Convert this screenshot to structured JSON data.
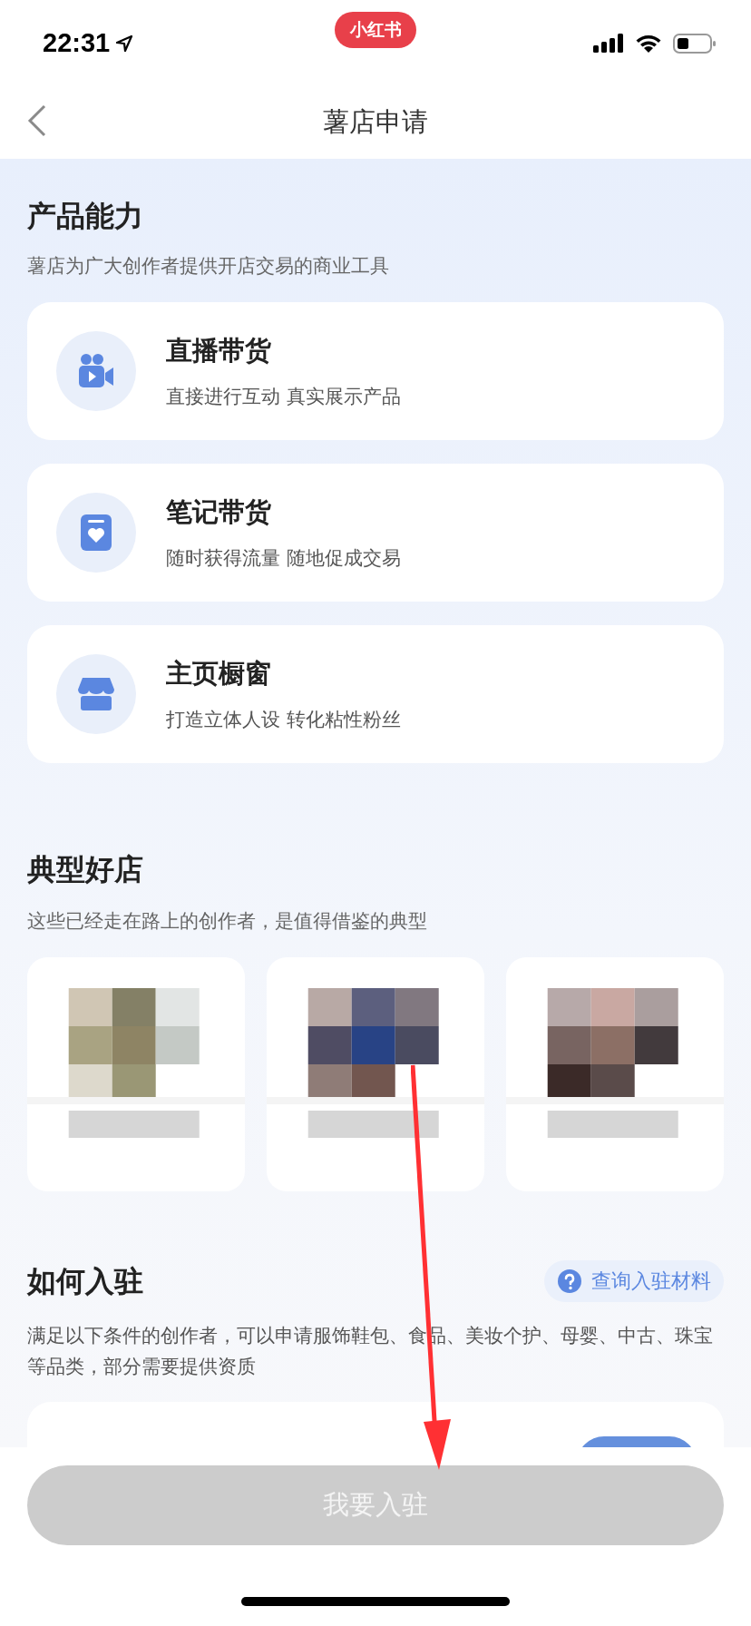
{
  "status_bar": {
    "time": "22:31",
    "app_badge": "小红书"
  },
  "nav": {
    "title": "薯店申请"
  },
  "product_section": {
    "title": "产品能力",
    "subtitle": "薯店为广大创作者提供开店交易的商业工具",
    "features": [
      {
        "kind": "live",
        "title": "直播带货",
        "description": "直接进行互动 真实展示产品"
      },
      {
        "kind": "note",
        "title": "笔记带货",
        "description": "随时获得流量 随地促成交易"
      },
      {
        "kind": "shop",
        "title": "主页橱窗",
        "description": "打造立体人设 转化粘性粉丝"
      }
    ]
  },
  "stores_section": {
    "title": "典型好店",
    "subtitle": "这些已经走在路上的创作者，是值得借鉴的典型"
  },
  "join_section": {
    "title": "如何入驻",
    "help_link": "查询入驻材料",
    "description": "满足以下条件的创作者，可以申请服饰鞋包、食品、美妆个护、母婴、中古、珠宝等品类，部分需要提供资质"
  },
  "join_button": {
    "label": "我要入驻",
    "disabled": true
  }
}
